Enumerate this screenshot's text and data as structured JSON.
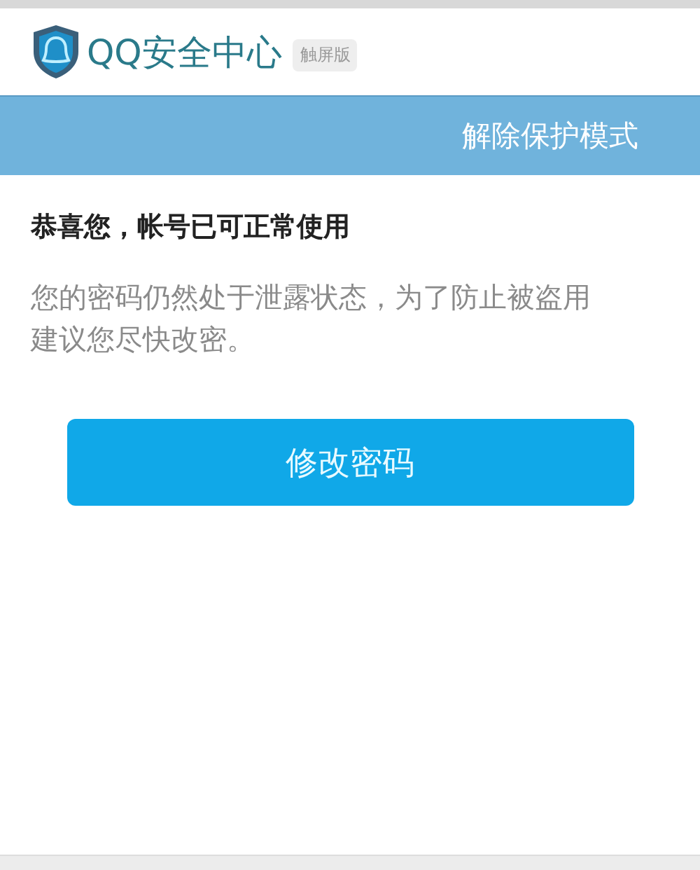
{
  "header": {
    "title": "QQ安全中心",
    "badge": "触屏版"
  },
  "banner": {
    "title": "解除保护模式"
  },
  "message": {
    "heading": "恭喜您，帐号已可正常使用",
    "body": "您的密码仍然处于泄露状态，为了防止被盗用建议您尽快改密。"
  },
  "buttons": [
    {
      "label": "修改密码",
      "kind": "primary"
    }
  ]
}
